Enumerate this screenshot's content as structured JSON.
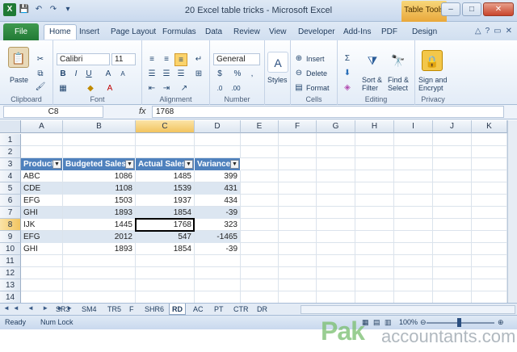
{
  "window": {
    "title": "20 Excel table tricks - Microsoft Excel",
    "contextual_tab": "Table Tools",
    "controls": [
      "–",
      "□",
      "✕"
    ]
  },
  "ribbon_tabs": [
    "File",
    "Home",
    "Insert",
    "Page Layout",
    "Formulas",
    "Data",
    "Review",
    "View",
    "Developer",
    "Add-Ins",
    "PDF",
    "Design"
  ],
  "active_tab": "Home",
  "ribbon": {
    "clipboard": {
      "label": "Clipboard",
      "paste": "Paste"
    },
    "font": {
      "label": "Font",
      "name": "Calibri",
      "size": "11"
    },
    "alignment": {
      "label": "Alignment"
    },
    "number": {
      "label": "Number",
      "format": "General",
      "currency": "$",
      "percent": "%",
      "comma": ","
    },
    "styles": {
      "label": "Styles"
    },
    "cells": {
      "label": "Cells",
      "insert": "Insert",
      "delete": "Delete",
      "format": "Format"
    },
    "editing": {
      "label": "Editing",
      "sort_filter": [
        "Sort &",
        "Filter"
      ],
      "find_select": [
        "Find &",
        "Select"
      ]
    },
    "privacy": {
      "label": "Privacy",
      "sign": [
        "Sign and",
        "Encrypt"
      ]
    }
  },
  "formula_bar": {
    "name_box": "C8",
    "fx": "fx",
    "value": "1768"
  },
  "columns": [
    "A",
    "B",
    "C",
    "D",
    "E",
    "F",
    "G",
    "H",
    "I",
    "J",
    "K"
  ],
  "rows": [
    "1",
    "2",
    "3",
    "4",
    "5",
    "6",
    "7",
    "8",
    "9",
    "10",
    "11",
    "12",
    "13",
    "14"
  ],
  "selected": {
    "column": "C",
    "row": "8"
  },
  "table": {
    "headers": [
      "Product",
      "Budgeted Sales",
      "Actual Sales",
      "Variance"
    ],
    "rows": [
      [
        "ABC",
        "1086",
        "1485",
        "399"
      ],
      [
        "CDE",
        "1108",
        "1539",
        "431"
      ],
      [
        "EFG",
        "1503",
        "1937",
        "434"
      ],
      [
        "GHI",
        "1893",
        "1854",
        "-39"
      ],
      [
        "IJK",
        "1445",
        "1768",
        "323"
      ],
      [
        "EFG",
        "2012",
        "547",
        "-1465"
      ],
      [
        "GHI",
        "1893",
        "1854",
        "-39"
      ]
    ]
  },
  "sheet_tabs": [
    "SR3",
    "SM4",
    "TR5",
    "F",
    "SHR6",
    "RD",
    "AC",
    "PT",
    "CTR",
    "DR"
  ],
  "active_sheet": "RD",
  "status": {
    "ready": "Ready",
    "num_lock": "Num Lock",
    "zoom": "100%"
  },
  "watermark": {
    "main": "Pak",
    "rest": "accountants.com"
  }
}
